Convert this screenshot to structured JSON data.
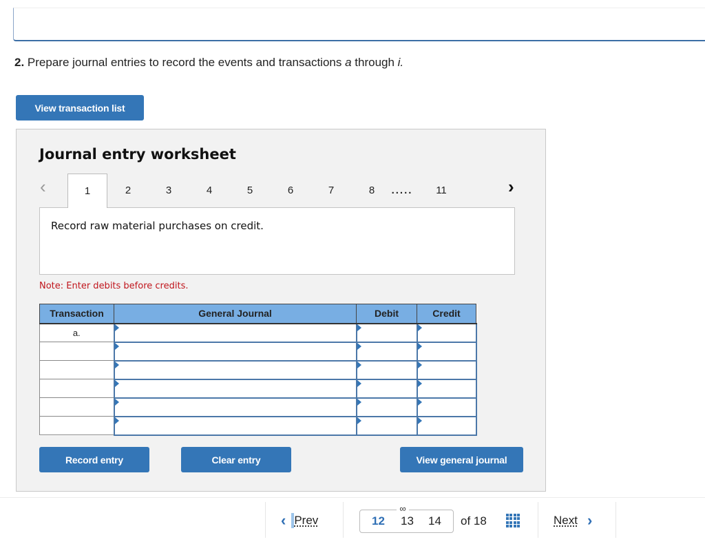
{
  "question": {
    "number": "2.",
    "text_before": "Prepare journal entries to record the events and transactions ",
    "italic_a": "a",
    "text_middle": " through ",
    "italic_i": "i."
  },
  "buttons": {
    "view_transaction_list": "View transaction list",
    "record_entry": "Record entry",
    "clear_entry": "Clear entry",
    "view_general_journal": "View general journal"
  },
  "worksheet": {
    "title": "Journal entry worksheet",
    "tabs": [
      "1",
      "2",
      "3",
      "4",
      "5",
      "6",
      "7",
      "8",
      "11"
    ],
    "active_tab": "1",
    "ellipsis": ".....",
    "prev_icon": "chevron-left-icon",
    "next_icon": "chevron-right-icon",
    "description": "Record raw material purchases on credit.",
    "note": "Note: Enter debits before credits."
  },
  "journal_table": {
    "headers": [
      "Transaction",
      "General Journal",
      "Debit",
      "Credit"
    ],
    "rows": [
      {
        "transaction": "a.",
        "account": "",
        "debit": "",
        "credit": ""
      },
      {
        "transaction": "",
        "account": "",
        "debit": "",
        "credit": ""
      },
      {
        "transaction": "",
        "account": "",
        "debit": "",
        "credit": ""
      },
      {
        "transaction": "",
        "account": "",
        "debit": "",
        "credit": ""
      },
      {
        "transaction": "",
        "account": "",
        "debit": "",
        "credit": ""
      },
      {
        "transaction": "",
        "account": "",
        "debit": "",
        "credit": ""
      }
    ]
  },
  "pagination": {
    "prev_label": "Prev",
    "next_label": "Next",
    "pages": [
      "12",
      "13",
      "14"
    ],
    "current_page": "12",
    "of_label": "of 18",
    "link_icon": "link-icon",
    "grid_icon": "grid-icon"
  },
  "colors": {
    "accent": "#3476b7",
    "header_bg": "#78aee3",
    "note_red": "#c0151c",
    "worksheet_bg": "#f2f2f2"
  }
}
